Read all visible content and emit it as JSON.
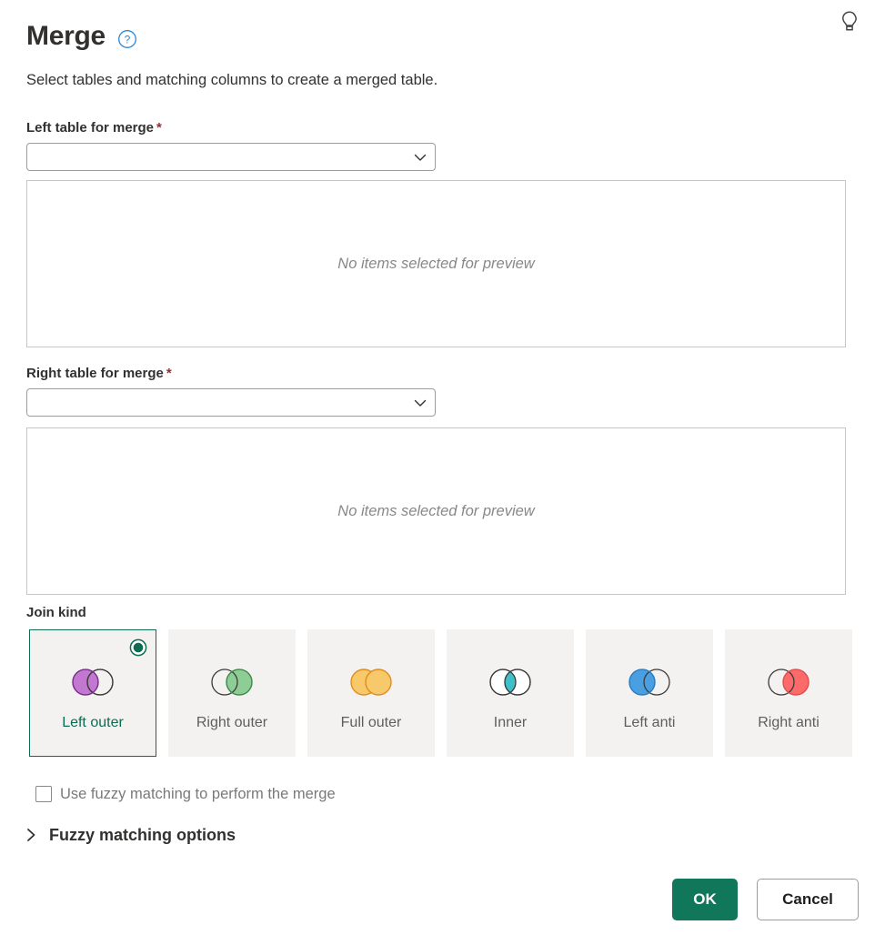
{
  "dialog": {
    "title": "Merge",
    "subtitle": "Select tables and matching columns to create a merged table.",
    "help_icon": "help-circle-icon",
    "tip_icon": "lightbulb-icon"
  },
  "left_table": {
    "label": "Left table for merge",
    "required_marker": "*",
    "value": "",
    "placeholder": "",
    "chevron_icon": "chevron-down-icon",
    "preview_empty_text": "No items selected for preview"
  },
  "right_table": {
    "label": "Right table for merge",
    "required_marker": "*",
    "value": "",
    "placeholder": "",
    "chevron_icon": "chevron-down-icon",
    "preview_empty_text": "No items selected for preview"
  },
  "join_kind": {
    "label": "Join kind",
    "selected": "Left outer",
    "options": [
      {
        "label": "Left outer",
        "fill": "left",
        "color": "#b455c8",
        "selected": true
      },
      {
        "label": "Right outer",
        "fill": "right",
        "color": "#6cc077",
        "selected": false
      },
      {
        "label": "Full outer",
        "fill": "both",
        "color": "#f7c96b",
        "stroke": "#e08d1c",
        "selected": false
      },
      {
        "label": "Inner",
        "fill": "intersect",
        "color": "#3fc0c9",
        "selected": false
      },
      {
        "label": "Left anti",
        "fill": "left-only",
        "color": "#4a9fe0",
        "selected": false
      },
      {
        "label": "Right anti",
        "fill": "right-only",
        "color": "#fc6a6a",
        "selected": false
      }
    ]
  },
  "fuzzy": {
    "checkbox_label": "Use fuzzy matching to perform the merge",
    "checked": false,
    "expander_label": "Fuzzy matching options",
    "expander_expanded": false,
    "expander_icon": "chevron-right-icon"
  },
  "footer": {
    "ok_label": "OK",
    "cancel_label": "Cancel"
  },
  "colors": {
    "accent_teal": "#11775b",
    "required_red": "#a4262c",
    "help_blue": "#0078d4",
    "tile_bg": "#f3f2f1"
  }
}
